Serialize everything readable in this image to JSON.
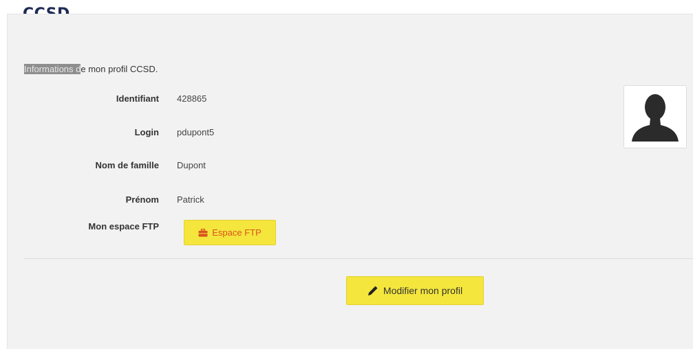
{
  "brand": {
    "logo_text": "CCSD",
    "dot_colors": [
      "#e94f37",
      "#f5a623",
      "#4a90e2",
      "#c86dd7"
    ]
  },
  "profile": {
    "intro_selected": "Informations d",
    "intro_rest": "e mon profil CCSD.",
    "fields": [
      {
        "label": "Identifiant",
        "value": "428865"
      },
      {
        "label": "Login",
        "value": "pdupont5"
      },
      {
        "label": "Nom de famille",
        "value": "Dupont"
      },
      {
        "label": "Prénom",
        "value": "Patrick"
      },
      {
        "label": "Mon espace FTP",
        "value": ""
      }
    ],
    "ftp_button_label": "Espace FTP",
    "edit_button_label": "Modifier mon profil"
  },
  "colors": {
    "button_bg": "#f4e63c",
    "ftp_text": "#d9531e",
    "panel_bg": "#f2f2f2"
  },
  "icons": {
    "ftp": "briefcase-icon",
    "edit": "pencil-icon",
    "avatar": "user-silhouette-icon"
  }
}
